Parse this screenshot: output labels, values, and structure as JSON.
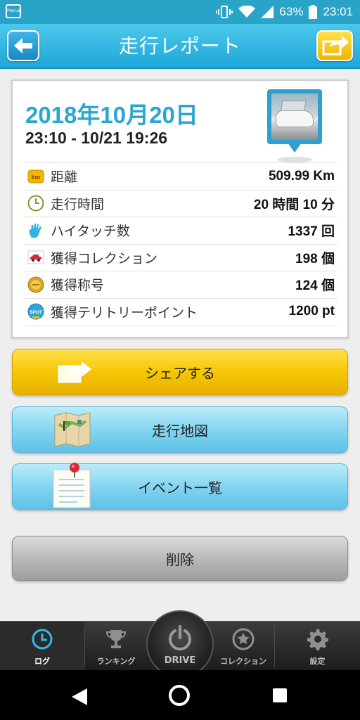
{
  "status_bar": {
    "app_icon_text": "Maruai",
    "battery_percent": "63%",
    "time": "23:01"
  },
  "header": {
    "title": "走行レポート"
  },
  "report": {
    "date": "2018年10月20日",
    "time_range": "23:10 - 10/21 19:26",
    "stats": [
      {
        "icon": "km-icon",
        "label": "距離",
        "value": "509.99 Km"
      },
      {
        "icon": "clock-icon",
        "label": "走行時間",
        "value": "20 時間 10 分"
      },
      {
        "icon": "hand-icon",
        "label": "ハイタッチ数",
        "value": "1337 回"
      },
      {
        "icon": "car-icon",
        "label": "獲得コレクション",
        "value": "198 個"
      },
      {
        "icon": "medal-icon",
        "label": "獲得称号",
        "value": "124 個"
      },
      {
        "icon": "spot-icon",
        "label": "獲得テリトリーポイント",
        "value": "1200 pt"
      }
    ]
  },
  "buttons": {
    "share": "シェアする",
    "map": "走行地図",
    "events": "イベント一覧",
    "delete": "削除"
  },
  "tabs": {
    "log": "ログ",
    "ranking": "ランキング",
    "drive": "DRIVE",
    "collection": "コレクション",
    "settings": "設定"
  },
  "colors": {
    "header": "#29a3c7",
    "date_accent": "#2aa6cf",
    "share_button": "#f5c400",
    "map_button": "#7fd3ef",
    "delete_button": "#b6b6b6"
  }
}
